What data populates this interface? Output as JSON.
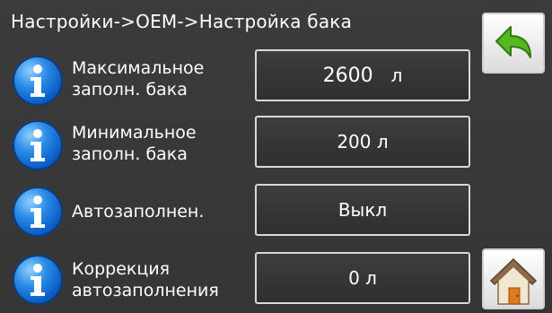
{
  "breadcrumb": "Настройки->OEM->Настройка бака",
  "rows": [
    {
      "label_line1": "Максимальное",
      "label_line2": "заполн. бака",
      "value": "2600",
      "unit": "л"
    },
    {
      "label_line1": "Минимальное",
      "label_line2": "заполн. бака",
      "value": "200 л"
    },
    {
      "label_line1": "Автозаполнен.",
      "value": "Выкл"
    },
    {
      "label_line1": "Коррекция",
      "label_line2": "автозаполнения",
      "value": "0 л"
    }
  ],
  "icons": {
    "info": "info-icon",
    "back": "back-arrow-icon",
    "home": "home-icon"
  },
  "colors": {
    "background": "#3a3a3a",
    "info_blue": "#1a73d8",
    "back_green": "#4caf20",
    "home_orange": "#e07a1f"
  }
}
